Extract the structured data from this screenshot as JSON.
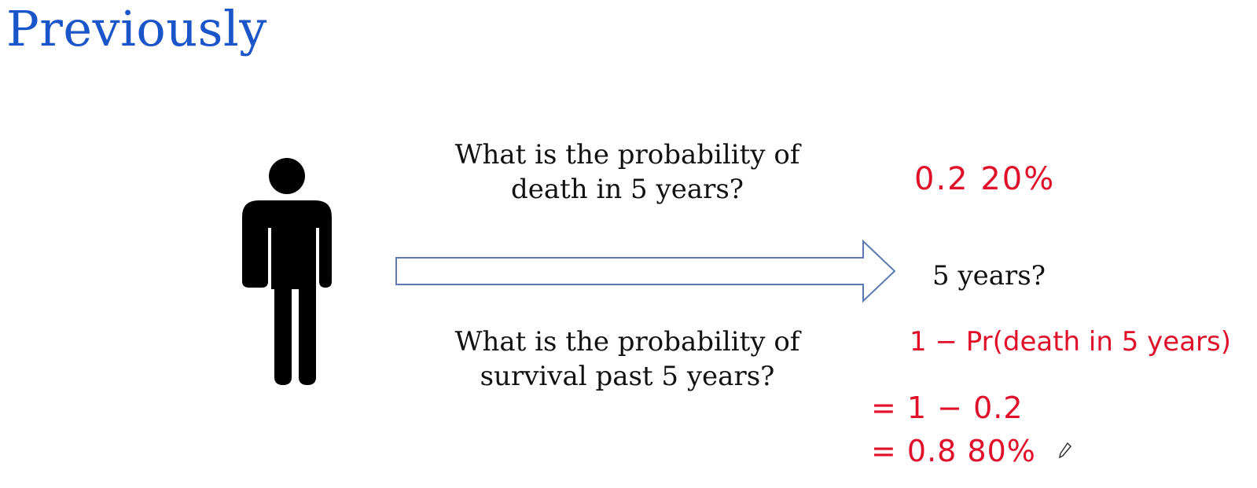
{
  "slide": {
    "title": "Previously"
  },
  "questions": {
    "death_line1": "What is the probability of",
    "death_line2": "death in 5 years?",
    "survival_line1": "What is the probability of",
    "survival_line2": "survival past 5 years?"
  },
  "arrow_label": "5 years?",
  "handwriting": {
    "death_answer": "0.2   20%",
    "survival_formula": "1 − Pr(death in 5 years)",
    "step_one": "= 1 − 0.2",
    "step_two": "= 0.8   80%"
  },
  "colors": {
    "title": "#1a56c9",
    "text": "#111111",
    "handwriting": "#e0102a",
    "arrow_stroke": "#5b7bb0",
    "icon": "#000000"
  },
  "icons": {
    "person": "person-icon",
    "arrow": "right-arrow-icon",
    "cursor": "pen-cursor-icon"
  }
}
